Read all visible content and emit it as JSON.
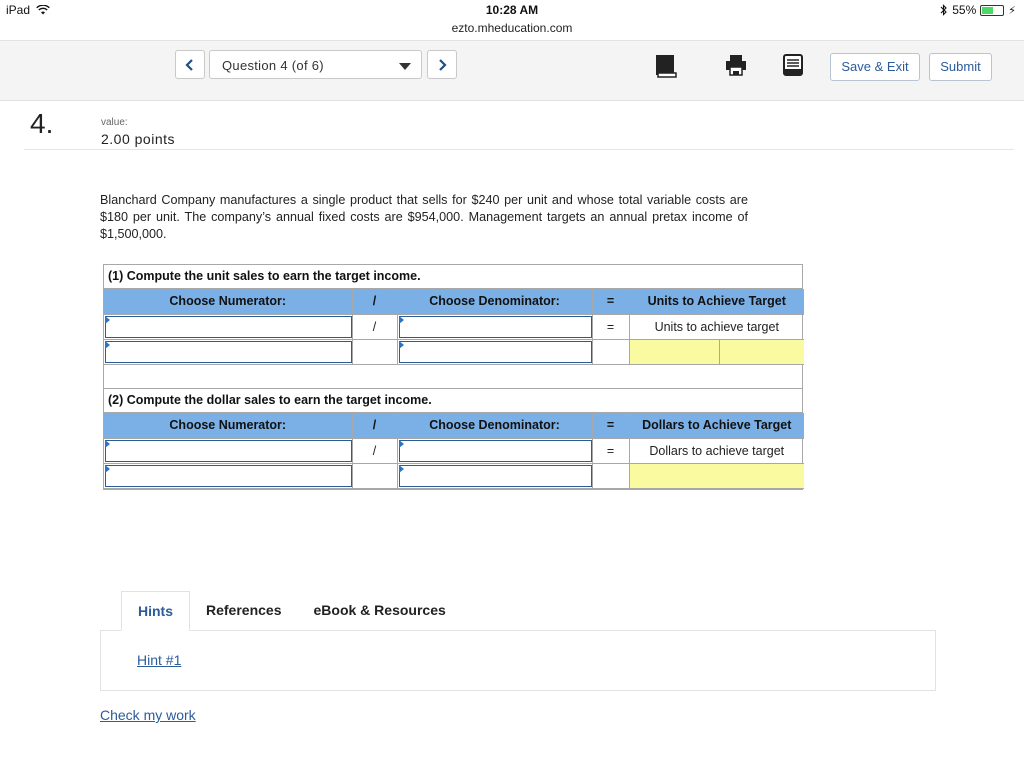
{
  "status_bar": {
    "device": "iPad",
    "time": "10:28 AM",
    "battery": "55%",
    "battery_level": 0.55
  },
  "browser": {
    "url": "ezto.mheducation.com"
  },
  "nav": {
    "prev_icon": "chevron-left-icon",
    "next_icon": "chevron-right-icon",
    "question_select": "Question 4 (of 6)",
    "tools": [
      "book-icon",
      "print-icon",
      "notes-icon"
    ],
    "save_exit": "Save & Exit",
    "submit": "Submit"
  },
  "question": {
    "number": "4.",
    "value_label": "value:",
    "points": "2.00 points",
    "text": "Blanchard Company manufactures a single product that sells for $240 per unit and whose total variable costs are $180 per unit. The company’s annual fixed costs are $954,000. Management targets an annual pretax income of $1,500,000."
  },
  "part1": {
    "title": "(1) Compute the unit sales to earn the target income.",
    "header": {
      "numerator": "Choose Numerator:",
      "divide": "/",
      "denominator": "Choose Denominator:",
      "equals": "=",
      "result": "Units to Achieve Target"
    },
    "row1": {
      "divide": "/",
      "equals": "=",
      "result_label": "Units to achieve target"
    }
  },
  "part2": {
    "title": "(2) Compute the dollar sales to earn the target income.",
    "header": {
      "numerator": "Choose Numerator:",
      "divide": "/",
      "denominator": "Choose Denominator:",
      "equals": "=",
      "result": "Dollars to Achieve Target"
    },
    "row1": {
      "divide": "/",
      "equals": "=",
      "result_label": "Dollars to achieve target"
    }
  },
  "tabs": [
    "Hints",
    "References",
    "eBook & Resources"
  ],
  "active_tab": "Hints",
  "hint_link": "Hint #1",
  "check_link": "Check my work",
  "colors": {
    "header_blue": "#7bb0e6",
    "input_border": "#2a5d98",
    "answer_yellow": "#fafaa0",
    "link_blue": "#2c5c9a"
  }
}
